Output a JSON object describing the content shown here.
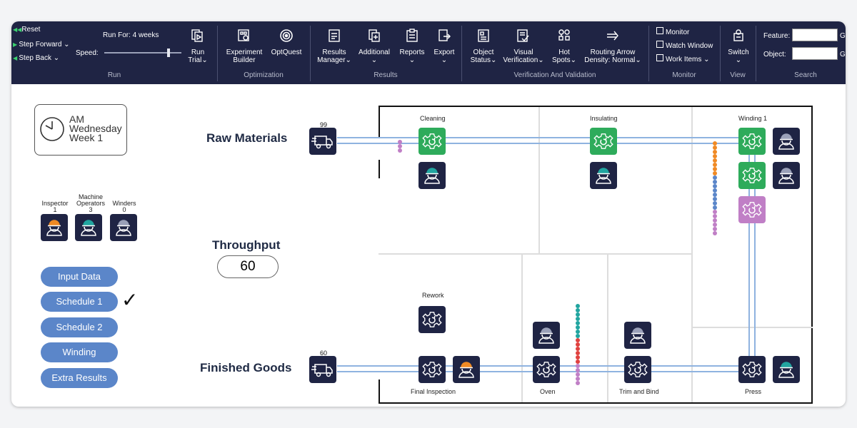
{
  "ribbon": {
    "run": {
      "reset": "Reset",
      "step_forward": "Step Forward",
      "step_back": "Step Back",
      "run_for": "Run For: 4 weeks",
      "speed": "Speed:",
      "run_trial_1": "Run",
      "run_trial_2": "Trial",
      "group": "Run"
    },
    "optimization": {
      "experiment_builder_1": "Experiment",
      "experiment_builder_2": "Builder",
      "optquest": "OptQuest",
      "group": "Optimization"
    },
    "results": {
      "results_manager_1": "Results",
      "results_manager_2": "Manager",
      "additional": "Additional",
      "reports": "Reports",
      "export": "Export",
      "group": "Results"
    },
    "verification": {
      "object_status_1": "Object",
      "object_status_2": "Status",
      "visual_verification_1": "Visual",
      "visual_verification_2": "Verification",
      "hot_spots_1": "Hot",
      "hot_spots_2": "Spots",
      "routing_arrow_1": "Routing Arrow",
      "routing_arrow_2": "Density: Normal",
      "group": "Verification And Validation"
    },
    "monitor": {
      "monitor": "Monitor",
      "watch_window": "Watch Window",
      "work_items": "Work Items",
      "group": "Monitor"
    },
    "view": {
      "switch": "Switch",
      "group": "View"
    },
    "search": {
      "feature": "Feature:",
      "object": "Object:",
      "feature_value": "",
      "object_value": "",
      "go_1": "G",
      "go_2": "G",
      "group": "Search"
    }
  },
  "clock": {
    "line1": "AM",
    "line2": "Wednesday",
    "line3": "Week 1"
  },
  "resources": [
    {
      "label": "Inspector",
      "count": "1",
      "helmet": "#f08a24"
    },
    {
      "label_line1": "Machine",
      "label_line2": "Operators",
      "count": "3",
      "helmet": "#21a5a0"
    },
    {
      "label": "Winders",
      "count": "0",
      "helmet": "#9aa0b8"
    }
  ],
  "scenarios": {
    "input_data": "Input Data",
    "schedule_1": "Schedule 1",
    "schedule_2": "Schedule 2",
    "winding": "Winding",
    "extra_results": "Extra Results",
    "check": "✓"
  },
  "labels": {
    "raw_materials": "Raw Materials",
    "throughput": "Throughput",
    "throughput_value": "60",
    "finished_goods": "Finished Goods",
    "raw_count": "99",
    "finished_count": "60"
  },
  "stations": {
    "cleaning": "Cleaning",
    "insulating": "Insulating",
    "winding_1": "Winding 1",
    "rework": "Rework",
    "final_inspection": "Final Inspection",
    "oven": "Oven",
    "trim_and_bind": "Trim and Bind",
    "press": "Press"
  },
  "colors": {
    "ribbon_bg": "#1f2444",
    "tile_dark": "#1f2444",
    "tile_busy": "#2eab5b",
    "tile_blocked": "#c07fc6",
    "pill": "#5b86c9",
    "conveyor": "#8fb3e0"
  }
}
